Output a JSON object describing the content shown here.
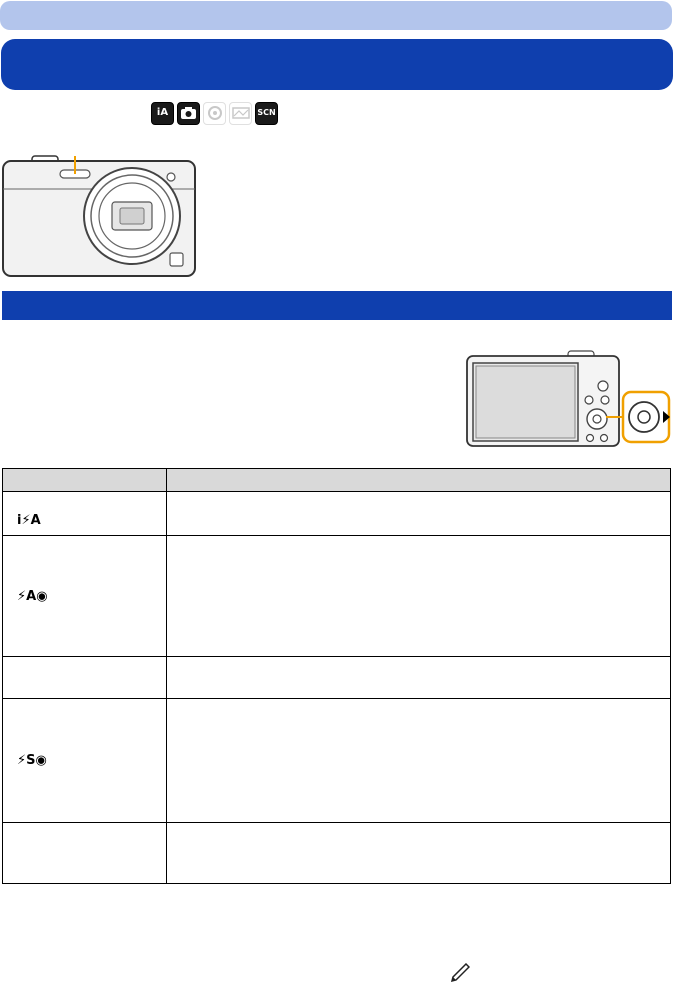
{
  "mode_icons": [
    {
      "label": "iA",
      "icon": "intelligent-auto-icon",
      "style": "dark"
    },
    {
      "label": "",
      "icon": "camera-program-icon",
      "style": "dark"
    },
    {
      "label": "",
      "icon": "creative-control-icon",
      "style": "light"
    },
    {
      "label": "",
      "icon": "panorama-icon",
      "style": "light"
    },
    {
      "label": "SCN",
      "icon": "scene-mode-icon",
      "style": "dark"
    }
  ],
  "flash_table": {
    "header": [
      "",
      ""
    ],
    "rows": [
      {
        "icon": "i⚡A",
        "icon_name": "flash-ia-icon",
        "description": ""
      },
      {
        "icon": "⚡A◉",
        "icon_name": "flash-auto-redeye-icon",
        "description": ""
      },
      {
        "icon": "",
        "icon_name": "flash-blank-icon",
        "description": ""
      },
      {
        "icon": "⚡S◉",
        "icon_name": "flash-slow-sync-redeye-icon",
        "description": ""
      },
      {
        "icon": "",
        "icon_name": "flash-blank-icon",
        "description": ""
      }
    ]
  },
  "colors": {
    "header_light_blue": "#b3c5ec",
    "header_dark_blue": "#0f3fae",
    "highlight_orange": "#f0a000"
  }
}
